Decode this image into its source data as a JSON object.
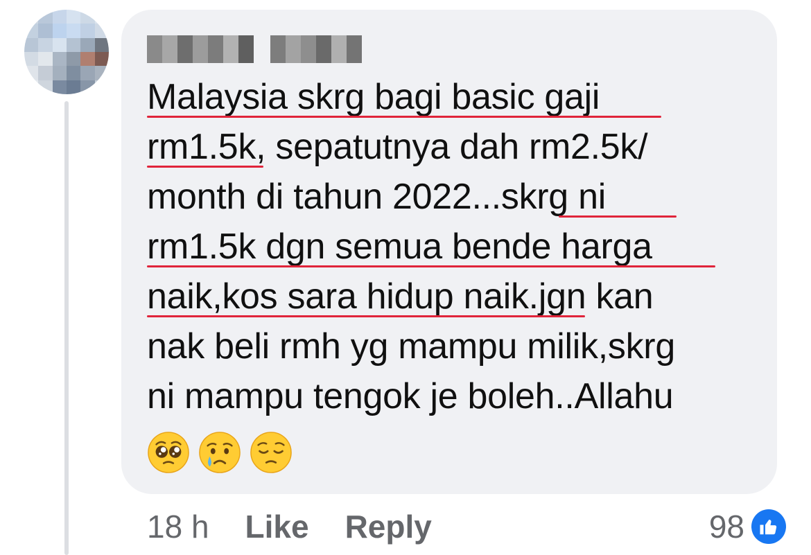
{
  "comment": {
    "author_name": "",
    "lines": [
      "Malaysia skrg bagi basic gaji",
      "rm1.5k, sepatutnya dah rm2.5k/",
      "month di tahun 2022...skrg ni",
      "rm1.5k dgn semua bende harga",
      "naik,kos sara hidup naik.jgn kan",
      "nak beli rmh yg mampu milik,skrg",
      "ni mampu tengok je boleh..Allahu"
    ],
    "emojis": [
      "pleading-face",
      "crying-face",
      "pensive-face"
    ]
  },
  "meta": {
    "time": "18 h",
    "like_label": "Like",
    "reply_label": "Reply",
    "reaction_count": "98"
  },
  "colors": {
    "bubble": "#f0f1f4",
    "underline": "#e0243a",
    "like_blue": "#1877f2",
    "meta_text": "#65676b"
  }
}
